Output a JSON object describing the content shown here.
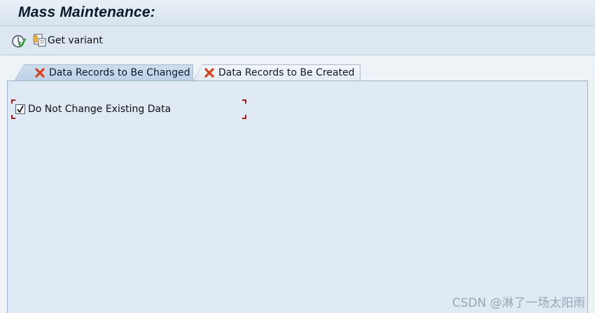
{
  "window": {
    "title": "Mass Maintenance:"
  },
  "toolbar": {
    "execute_icon": "execute-icon",
    "get_variant_label": "Get variant",
    "get_variant_icon": "get-variant-icon"
  },
  "tabs": [
    {
      "label": "Data Records to Be Changed",
      "icon": "red-x-icon",
      "active": true
    },
    {
      "label": "Data Records to Be Created",
      "icon": "red-x-icon",
      "active": false
    }
  ],
  "panel": {
    "checkbox": {
      "label": "Do Not Change Existing Data",
      "checked": true
    }
  },
  "watermark": "CSDN @淋了一场太阳雨",
  "colors": {
    "frame_corner": "#a01818",
    "tab_icon": "#d9401b",
    "panel_bg": "#dfeaf5"
  }
}
